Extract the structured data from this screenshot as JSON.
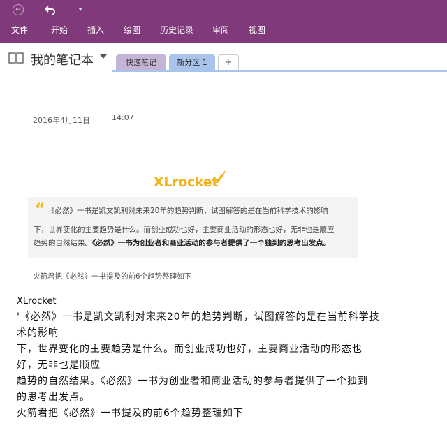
{
  "ribbon": {
    "menu": [
      "文件",
      "开始",
      "插入",
      "绘图",
      "历史记录",
      "审阅",
      "视图"
    ]
  },
  "colors": {
    "ribbon_bg": "#80397b",
    "tab_quick": "#c4b5d6",
    "tab_new": "#a8c4ea",
    "logo_yellow": "#f1b51b"
  },
  "notebook": {
    "title": "我的笔记本",
    "tabs": [
      "快速笔记",
      "新分区 1"
    ],
    "add_tab_label": "+"
  },
  "page": {
    "date": "2016年4月11日",
    "time": "14:07",
    "logo": {
      "xl": "XL",
      "rocket": "rocket"
    },
    "quote_mark": "“",
    "quote_lines": [
      "《必然》一书是凯文凯利对未来20年的趋势判断，试图解答的是在当前科学技术的影响",
      "下，世界变化的主要趋势是什么。而创业成功也好，主要商业活动的形态也好，无非也是顺应",
      "趋势的自然结果。"
    ],
    "quote_bold": "《必然》一书为创业者和商业活动的参与者提供了一个独到的思考出发点。",
    "caption": "火箭君把《必然》一书提及的前6个趋势整理如下",
    "body_lines": [
      "XLrocket",
      "'《必然》一书是凯文凯利对宋来20年的趋势判断，试图解答的是在当前科学技",
      "术的影响",
      "下，世界变化的主要趋势是什么。而创业成功也好，主要商业活动的形态也",
      "好，无非也是顺应",
      "趋势的自然结果。《必然》一书为创业者和商业活动的参与者提供了一个独到",
      "的思考出发点。",
      "火箭君把《必然》一书提及的前6个趋势整理如下"
    ]
  }
}
